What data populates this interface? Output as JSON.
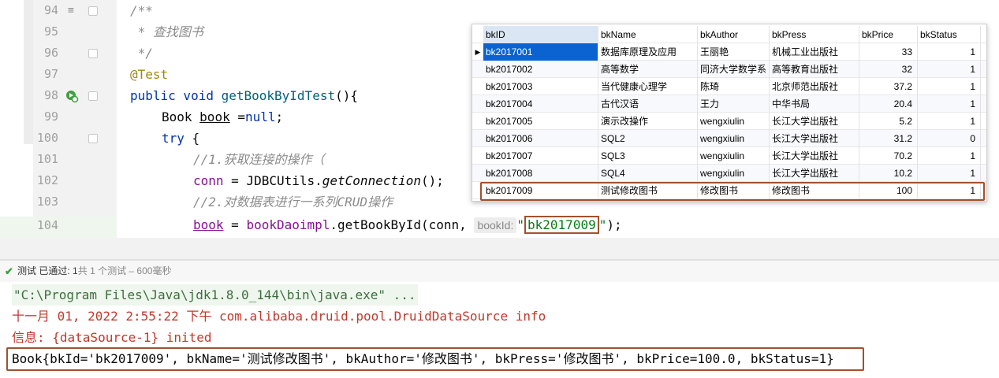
{
  "editor": {
    "lines": [
      {
        "num": "94"
      },
      {
        "num": "95"
      },
      {
        "num": "96"
      },
      {
        "num": "97"
      },
      {
        "num": "98"
      },
      {
        "num": "99"
      },
      {
        "num": "100"
      },
      {
        "num": "101"
      },
      {
        "num": "102"
      },
      {
        "num": "103"
      },
      {
        "num": "104"
      }
    ],
    "code": {
      "l94": "/**",
      "l95": " * 查找图书",
      "l96": " */",
      "l97": "@Test",
      "l98_kw": "public void ",
      "l98_name": "getBookByIdTest",
      "l98_rest": "(){",
      "l99_type": "Book ",
      "l99_var": "book",
      "l99_eq": " =",
      "l99_null": "null",
      "l99_end": ";",
      "l100_kw": "try",
      "l100_rest": " {",
      "l101": "//1.获取连接的操作（",
      "l102_var": "conn",
      "l102_mid": " = JDBCUtils.",
      "l102_call": "getConnection",
      "l102_end": "();",
      "l103": "//2.对数据表进行一系列CRUD操作",
      "l104_var": "book",
      "l104_eq": " = ",
      "l104_obj": "bookDaoimpl",
      "l104_call": ".getBookById(conn, ",
      "l104_hint": "bookId:",
      "l104_q1": "\"",
      "l104_str": "bk2017009",
      "l104_q2": "\"",
      "l104_end": ");"
    }
  },
  "db_table": {
    "columns": [
      "bkID",
      "bkName",
      "bkAuthor",
      "bkPress",
      "bkPrice",
      "bkStatus"
    ],
    "rows": [
      [
        "bk2017001",
        "数据库原理及应用",
        "王丽艳",
        "机械工业出版社",
        "33",
        "1"
      ],
      [
        "bk2017002",
        "高等数学",
        "同济大学数学系",
        "高等教育出版社",
        "32",
        "1"
      ],
      [
        "bk2017003",
        "当代健康心理学",
        "陈琦",
        "北京师范出版社",
        "37.2",
        "1"
      ],
      [
        "bk2017004",
        "古代汉语",
        "王力",
        "中华书局",
        "20.4",
        "1"
      ],
      [
        "bk2017005",
        "演示改操作",
        "wengxiulin",
        "长江大学出版社",
        "5.2",
        "1"
      ],
      [
        "bk2017006",
        "SQL2",
        "wengxiulin",
        "长江大学出版社",
        "31.2",
        "0"
      ],
      [
        "bk2017007",
        "SQL3",
        "wengxiulin",
        "长江大学出版社",
        "70.2",
        "1"
      ],
      [
        "bk2017008",
        "SQL4",
        "wengxiulin",
        "长江大学出版社",
        "10.2",
        "1"
      ],
      [
        "bk2017009",
        "测试修改图书",
        "修改图书",
        "修改图书",
        "100",
        "1"
      ]
    ]
  },
  "run": {
    "status_label": "测试",
    "status_passed": "已通过:",
    "status_count": "1",
    "status_rest": "共 1 个测试 – 600毫秒",
    "console": {
      "cmd": "\"C:\\Program Files\\Java\\jdk1.8.0_144\\bin\\java.exe\" ...",
      "log1": "十一月 01, 2022 2:55:22 下午 com.alibaba.druid.pool.DruidDataSource info",
      "log2": "信息: {dataSource-1} inited",
      "output": "Book{bkId='bk2017009', bkName='测试修改图书', bkAuthor='修改图书', bkPress='修改图书', bkPrice=100.0, bkStatus=1}"
    }
  },
  "colors": {
    "highlight_box": "#a0522d",
    "selection": "#0b63d1",
    "keyword": "#0033b3",
    "string": "#067d17",
    "error_text": "#c0392b"
  },
  "icons": [
    "list-icon",
    "run-test-icon",
    "fold-icon",
    "check-icon",
    "row-pointer-icon"
  ]
}
